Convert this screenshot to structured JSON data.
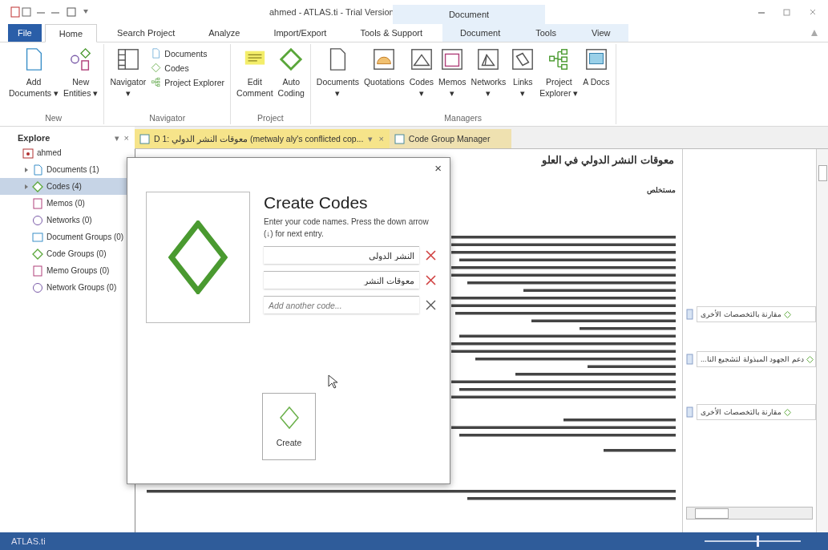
{
  "window": {
    "title": "ahmed - ATLAS.ti - Trial Version",
    "context_label": "Document"
  },
  "ribbon_tabs": [
    {
      "label": "File",
      "kind": "file",
      "selected": false
    },
    {
      "label": "Home",
      "kind": "tab",
      "selected": true
    },
    {
      "label": "Search Project",
      "kind": "tab",
      "selected": false
    },
    {
      "label": "Analyze",
      "kind": "tab",
      "selected": false
    },
    {
      "label": "Import/Export",
      "kind": "tab",
      "selected": false
    },
    {
      "label": "Tools & Support",
      "kind": "tab",
      "selected": false
    },
    {
      "label": "Document",
      "kind": "context",
      "selected": false
    },
    {
      "label": "Tools",
      "kind": "context",
      "selected": false
    },
    {
      "label": "View",
      "kind": "context",
      "selected": false
    }
  ],
  "ribbon_groups": [
    {
      "label": "New",
      "buttons": [
        {
          "kind": "large",
          "lines": [
            "Add",
            "Documents ▾"
          ]
        },
        {
          "kind": "large",
          "lines": [
            "New",
            "Entities ▾"
          ]
        }
      ]
    },
    {
      "label": "Navigator",
      "buttons": [
        {
          "kind": "large",
          "lines": [
            "Navigator",
            "▾"
          ]
        },
        {
          "kind": "small",
          "lines": [
            "Documents"
          ]
        },
        {
          "kind": "small",
          "lines": [
            "Codes"
          ]
        },
        {
          "kind": "small",
          "lines": [
            "Project Explorer"
          ]
        }
      ]
    },
    {
      "label": "Project",
      "buttons": [
        {
          "kind": "large",
          "lines": [
            "Edit",
            "Comment"
          ]
        },
        {
          "kind": "large",
          "lines": [
            "Auto",
            "Coding"
          ]
        }
      ]
    },
    {
      "label": "Managers",
      "buttons": [
        {
          "kind": "large",
          "lines": [
            "Documents",
            "▾"
          ]
        },
        {
          "kind": "large",
          "lines": [
            "Quotations"
          ]
        },
        {
          "kind": "large",
          "lines": [
            "Codes",
            "▾"
          ]
        },
        {
          "kind": "large",
          "lines": [
            "Memos",
            "▾"
          ]
        },
        {
          "kind": "large",
          "lines": [
            "Networks",
            "▾"
          ]
        },
        {
          "kind": "large",
          "lines": [
            "Links",
            "▾"
          ]
        },
        {
          "kind": "large",
          "lines": [
            "Project",
            "Explorer ▾"
          ]
        },
        {
          "kind": "large",
          "lines": [
            "A Docs"
          ]
        }
      ]
    }
  ],
  "explore": {
    "title": "Explore",
    "pin": "▾",
    "close": "×",
    "root": {
      "label": "ahmed",
      "children": [
        {
          "label": "Documents (1)",
          "expandable": true,
          "selected": false
        },
        {
          "label": "Codes (4)",
          "expandable": true,
          "selected": true
        },
        {
          "label": "Memos (0)",
          "expandable": false,
          "selected": false
        },
        {
          "label": "Networks (0)",
          "expandable": false,
          "selected": false
        },
        {
          "label": "Document Groups (0)",
          "expandable": false,
          "selected": false
        },
        {
          "label": "Code Groups (0)",
          "expandable": false,
          "selected": false
        },
        {
          "label": "Memo Groups (0)",
          "expandable": false,
          "selected": false
        },
        {
          "label": "Network Groups (0)",
          "expandable": false,
          "selected": false
        }
      ]
    }
  },
  "doc_tabs": [
    {
      "label": "D 1: معوقات النشر الدولي (metwaly aly's conflicted cop...",
      "selected": true,
      "menu": "▾",
      "close": "×"
    },
    {
      "label": "Code Group Manager",
      "selected": false
    }
  ],
  "document": {
    "title": "معوقات النشر الدولي في العلو",
    "heading": "مستخلص"
  },
  "margin_codes": [
    {
      "label": "مقارنة بالتخصصات الأخرى"
    },
    {
      "label": "...دعم الجهود المبذولة لتشجيع النا"
    },
    {
      "label": "مقارنة بالتخصصات الأخرى"
    }
  ],
  "dialog": {
    "close": "×",
    "title": "Create Codes",
    "description": "Enter your code names. Press the down arrow (↓) for next entry.",
    "entries": [
      {
        "value": "النشر الدولي"
      },
      {
        "value": "معوقات النشر"
      }
    ],
    "placeholder": "Add another code...",
    "create": "Create"
  },
  "status_bar": {
    "text": "ATLAS.ti",
    "zoom": {
      "level": 0.55
    }
  }
}
